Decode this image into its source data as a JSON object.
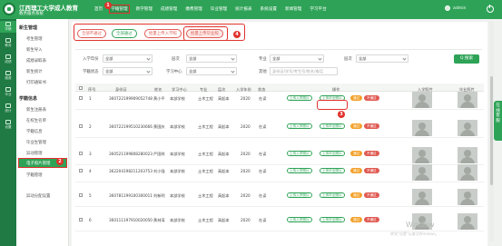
{
  "header": {
    "title": "江西理工大学成人教育",
    "subtitle": "教务服务系统",
    "nav": [
      "首页",
      "学籍管理",
      "教学管理",
      "成绩管理",
      "缴费管理",
      "毕业管理",
      "统计报表",
      "系统设置",
      "新闻管理",
      "学习平台"
    ],
    "user": "admin",
    "accent": "#2ea357"
  },
  "rail": [
    "学籍",
    "教务",
    "成绩",
    "缴费",
    "毕业",
    "统计",
    "设置"
  ],
  "sidenav": {
    "group1_title": "新生管理",
    "group1": [
      "考生管理",
      "新生导入",
      "成绩录取表",
      "新生统计",
      "打印通知书"
    ],
    "group2_title": "学籍信息",
    "group2": [
      "新生注册表",
      "在校生名单",
      "学籍信息",
      "毕业生管理",
      "异动管理",
      "学号编排设置",
      "学籍管理",
      "电子照片管理",
      "异动分配设置"
    ]
  },
  "badges": [
    "1",
    "2",
    "3",
    "4"
  ],
  "actions": {
    "fail": "全部不通过",
    "pass": "全部通过",
    "batch_upload_entry": "批量上传入学照",
    "batch_upload_grad": "批量上传毕业照"
  },
  "filters": {
    "entry_year_label": "入学年份",
    "entry_year": "全部",
    "level_label": "层次",
    "level": "全部",
    "major_label": "专业",
    "major": "全部",
    "batch_label": "层次",
    "batch": "全部",
    "status_label": "学籍状态",
    "status": "全部",
    "center_label": "学习中心",
    "center": "全部",
    "other_label": "其他",
    "other_placeholder": "身份证/学号/考生号/姓名/电话",
    "search": "Q 搜索"
  },
  "table": {
    "headers": [
      "序号",
      "身份证",
      "姓名",
      "学习中心",
      "专业",
      "层次",
      "入学年份",
      "状态",
      "操作",
      "入学照片",
      "毕业照片"
    ],
    "rows": [
      {
        "no": "1",
        "id": "360722199909052748",
        "name": "黄小平",
        "center": "本部学校",
        "major": "土木工程",
        "level": "高起本",
        "year": "2020",
        "status": "在读"
      },
      {
        "no": "2",
        "id": "360722199510230666",
        "name": "黄国庆",
        "center": "本部学校",
        "major": "土木工程",
        "level": "高起本",
        "year": "2020",
        "status": "在读"
      },
      {
        "no": "3",
        "id": "360521199808280023",
        "name": "严国祥",
        "center": "本部学校",
        "major": "土木工程",
        "level": "高起本",
        "year": "2020",
        "status": "在读"
      },
      {
        "no": "4",
        "id": "362204198211203753",
        "name": "刘小强",
        "center": "本部学校",
        "major": "土木工程",
        "level": "高起本",
        "year": "2020",
        "status": "在读"
      },
      {
        "no": "5",
        "id": "360781199100300011",
        "name": "刘新明",
        "center": "本部学校",
        "major": "土木工程",
        "level": "高起本",
        "year": "2020",
        "status": "在读"
      },
      {
        "no": "6",
        "id": "360111197910020050",
        "name": "黄林涛",
        "center": "本部学校",
        "major": "土木工程",
        "level": "高起本",
        "year": "2020",
        "status": "在读"
      }
    ],
    "row_actions": {
      "upload_entry": "上传入学照片",
      "upload_grad": "上传毕业照片",
      "pass": "通过",
      "fail": "不通过"
    }
  },
  "float_tab": "在线客服",
  "watermark": "Window",
  "watermark_sub": "转到\"设置\"以激活Windows。"
}
